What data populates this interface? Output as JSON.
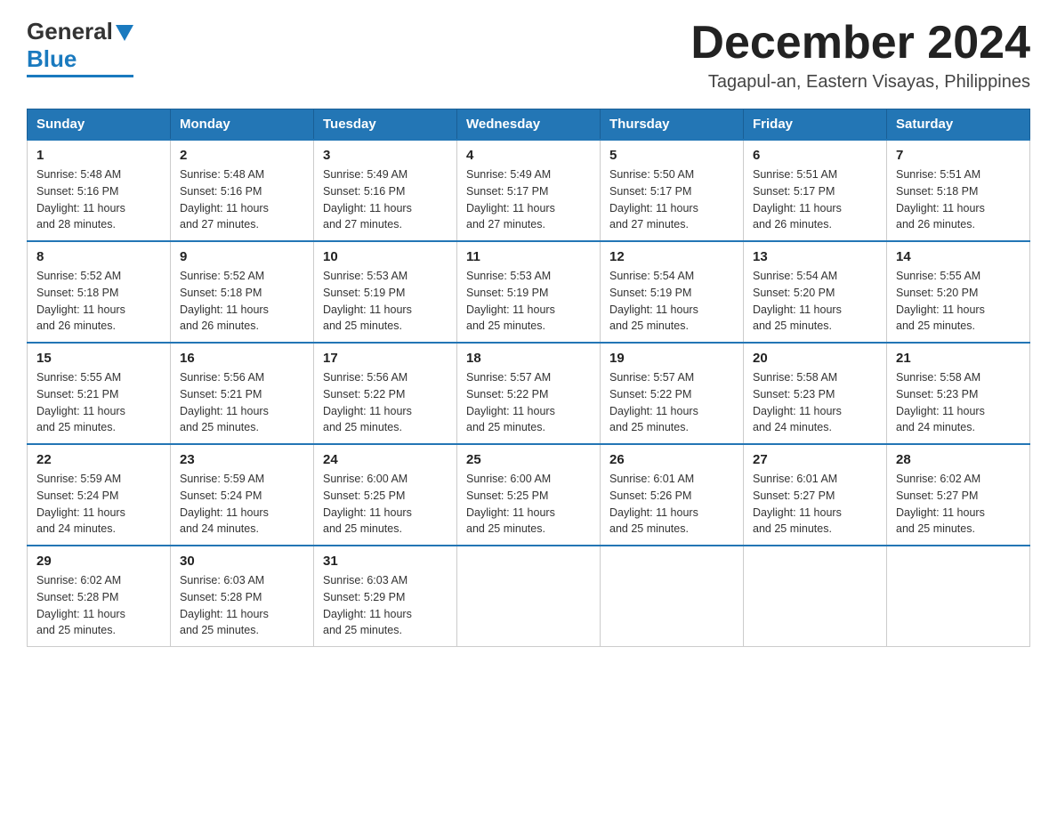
{
  "header": {
    "logo_general": "General",
    "logo_blue": "Blue",
    "month_title": "December 2024",
    "location": "Tagapul-an, Eastern Visayas, Philippines"
  },
  "days_of_week": [
    "Sunday",
    "Monday",
    "Tuesday",
    "Wednesday",
    "Thursday",
    "Friday",
    "Saturday"
  ],
  "weeks": [
    [
      {
        "day": "1",
        "sunrise": "5:48 AM",
        "sunset": "5:16 PM",
        "daylight": "11 hours and 28 minutes."
      },
      {
        "day": "2",
        "sunrise": "5:48 AM",
        "sunset": "5:16 PM",
        "daylight": "11 hours and 27 minutes."
      },
      {
        "day": "3",
        "sunrise": "5:49 AM",
        "sunset": "5:16 PM",
        "daylight": "11 hours and 27 minutes."
      },
      {
        "day": "4",
        "sunrise": "5:49 AM",
        "sunset": "5:17 PM",
        "daylight": "11 hours and 27 minutes."
      },
      {
        "day": "5",
        "sunrise": "5:50 AM",
        "sunset": "5:17 PM",
        "daylight": "11 hours and 27 minutes."
      },
      {
        "day": "6",
        "sunrise": "5:51 AM",
        "sunset": "5:17 PM",
        "daylight": "11 hours and 26 minutes."
      },
      {
        "day": "7",
        "sunrise": "5:51 AM",
        "sunset": "5:18 PM",
        "daylight": "11 hours and 26 minutes."
      }
    ],
    [
      {
        "day": "8",
        "sunrise": "5:52 AM",
        "sunset": "5:18 PM",
        "daylight": "11 hours and 26 minutes."
      },
      {
        "day": "9",
        "sunrise": "5:52 AM",
        "sunset": "5:18 PM",
        "daylight": "11 hours and 26 minutes."
      },
      {
        "day": "10",
        "sunrise": "5:53 AM",
        "sunset": "5:19 PM",
        "daylight": "11 hours and 25 minutes."
      },
      {
        "day": "11",
        "sunrise": "5:53 AM",
        "sunset": "5:19 PM",
        "daylight": "11 hours and 25 minutes."
      },
      {
        "day": "12",
        "sunrise": "5:54 AM",
        "sunset": "5:19 PM",
        "daylight": "11 hours and 25 minutes."
      },
      {
        "day": "13",
        "sunrise": "5:54 AM",
        "sunset": "5:20 PM",
        "daylight": "11 hours and 25 minutes."
      },
      {
        "day": "14",
        "sunrise": "5:55 AM",
        "sunset": "5:20 PM",
        "daylight": "11 hours and 25 minutes."
      }
    ],
    [
      {
        "day": "15",
        "sunrise": "5:55 AM",
        "sunset": "5:21 PM",
        "daylight": "11 hours and 25 minutes."
      },
      {
        "day": "16",
        "sunrise": "5:56 AM",
        "sunset": "5:21 PM",
        "daylight": "11 hours and 25 minutes."
      },
      {
        "day": "17",
        "sunrise": "5:56 AM",
        "sunset": "5:22 PM",
        "daylight": "11 hours and 25 minutes."
      },
      {
        "day": "18",
        "sunrise": "5:57 AM",
        "sunset": "5:22 PM",
        "daylight": "11 hours and 25 minutes."
      },
      {
        "day": "19",
        "sunrise": "5:57 AM",
        "sunset": "5:22 PM",
        "daylight": "11 hours and 25 minutes."
      },
      {
        "day": "20",
        "sunrise": "5:58 AM",
        "sunset": "5:23 PM",
        "daylight": "11 hours and 24 minutes."
      },
      {
        "day": "21",
        "sunrise": "5:58 AM",
        "sunset": "5:23 PM",
        "daylight": "11 hours and 24 minutes."
      }
    ],
    [
      {
        "day": "22",
        "sunrise": "5:59 AM",
        "sunset": "5:24 PM",
        "daylight": "11 hours and 24 minutes."
      },
      {
        "day": "23",
        "sunrise": "5:59 AM",
        "sunset": "5:24 PM",
        "daylight": "11 hours and 24 minutes."
      },
      {
        "day": "24",
        "sunrise": "6:00 AM",
        "sunset": "5:25 PM",
        "daylight": "11 hours and 25 minutes."
      },
      {
        "day": "25",
        "sunrise": "6:00 AM",
        "sunset": "5:25 PM",
        "daylight": "11 hours and 25 minutes."
      },
      {
        "day": "26",
        "sunrise": "6:01 AM",
        "sunset": "5:26 PM",
        "daylight": "11 hours and 25 minutes."
      },
      {
        "day": "27",
        "sunrise": "6:01 AM",
        "sunset": "5:27 PM",
        "daylight": "11 hours and 25 minutes."
      },
      {
        "day": "28",
        "sunrise": "6:02 AM",
        "sunset": "5:27 PM",
        "daylight": "11 hours and 25 minutes."
      }
    ],
    [
      {
        "day": "29",
        "sunrise": "6:02 AM",
        "sunset": "5:28 PM",
        "daylight": "11 hours and 25 minutes."
      },
      {
        "day": "30",
        "sunrise": "6:03 AM",
        "sunset": "5:28 PM",
        "daylight": "11 hours and 25 minutes."
      },
      {
        "day": "31",
        "sunrise": "6:03 AM",
        "sunset": "5:29 PM",
        "daylight": "11 hours and 25 minutes."
      },
      null,
      null,
      null,
      null
    ]
  ],
  "labels": {
    "sunrise": "Sunrise:",
    "sunset": "Sunset:",
    "daylight": "Daylight:"
  }
}
